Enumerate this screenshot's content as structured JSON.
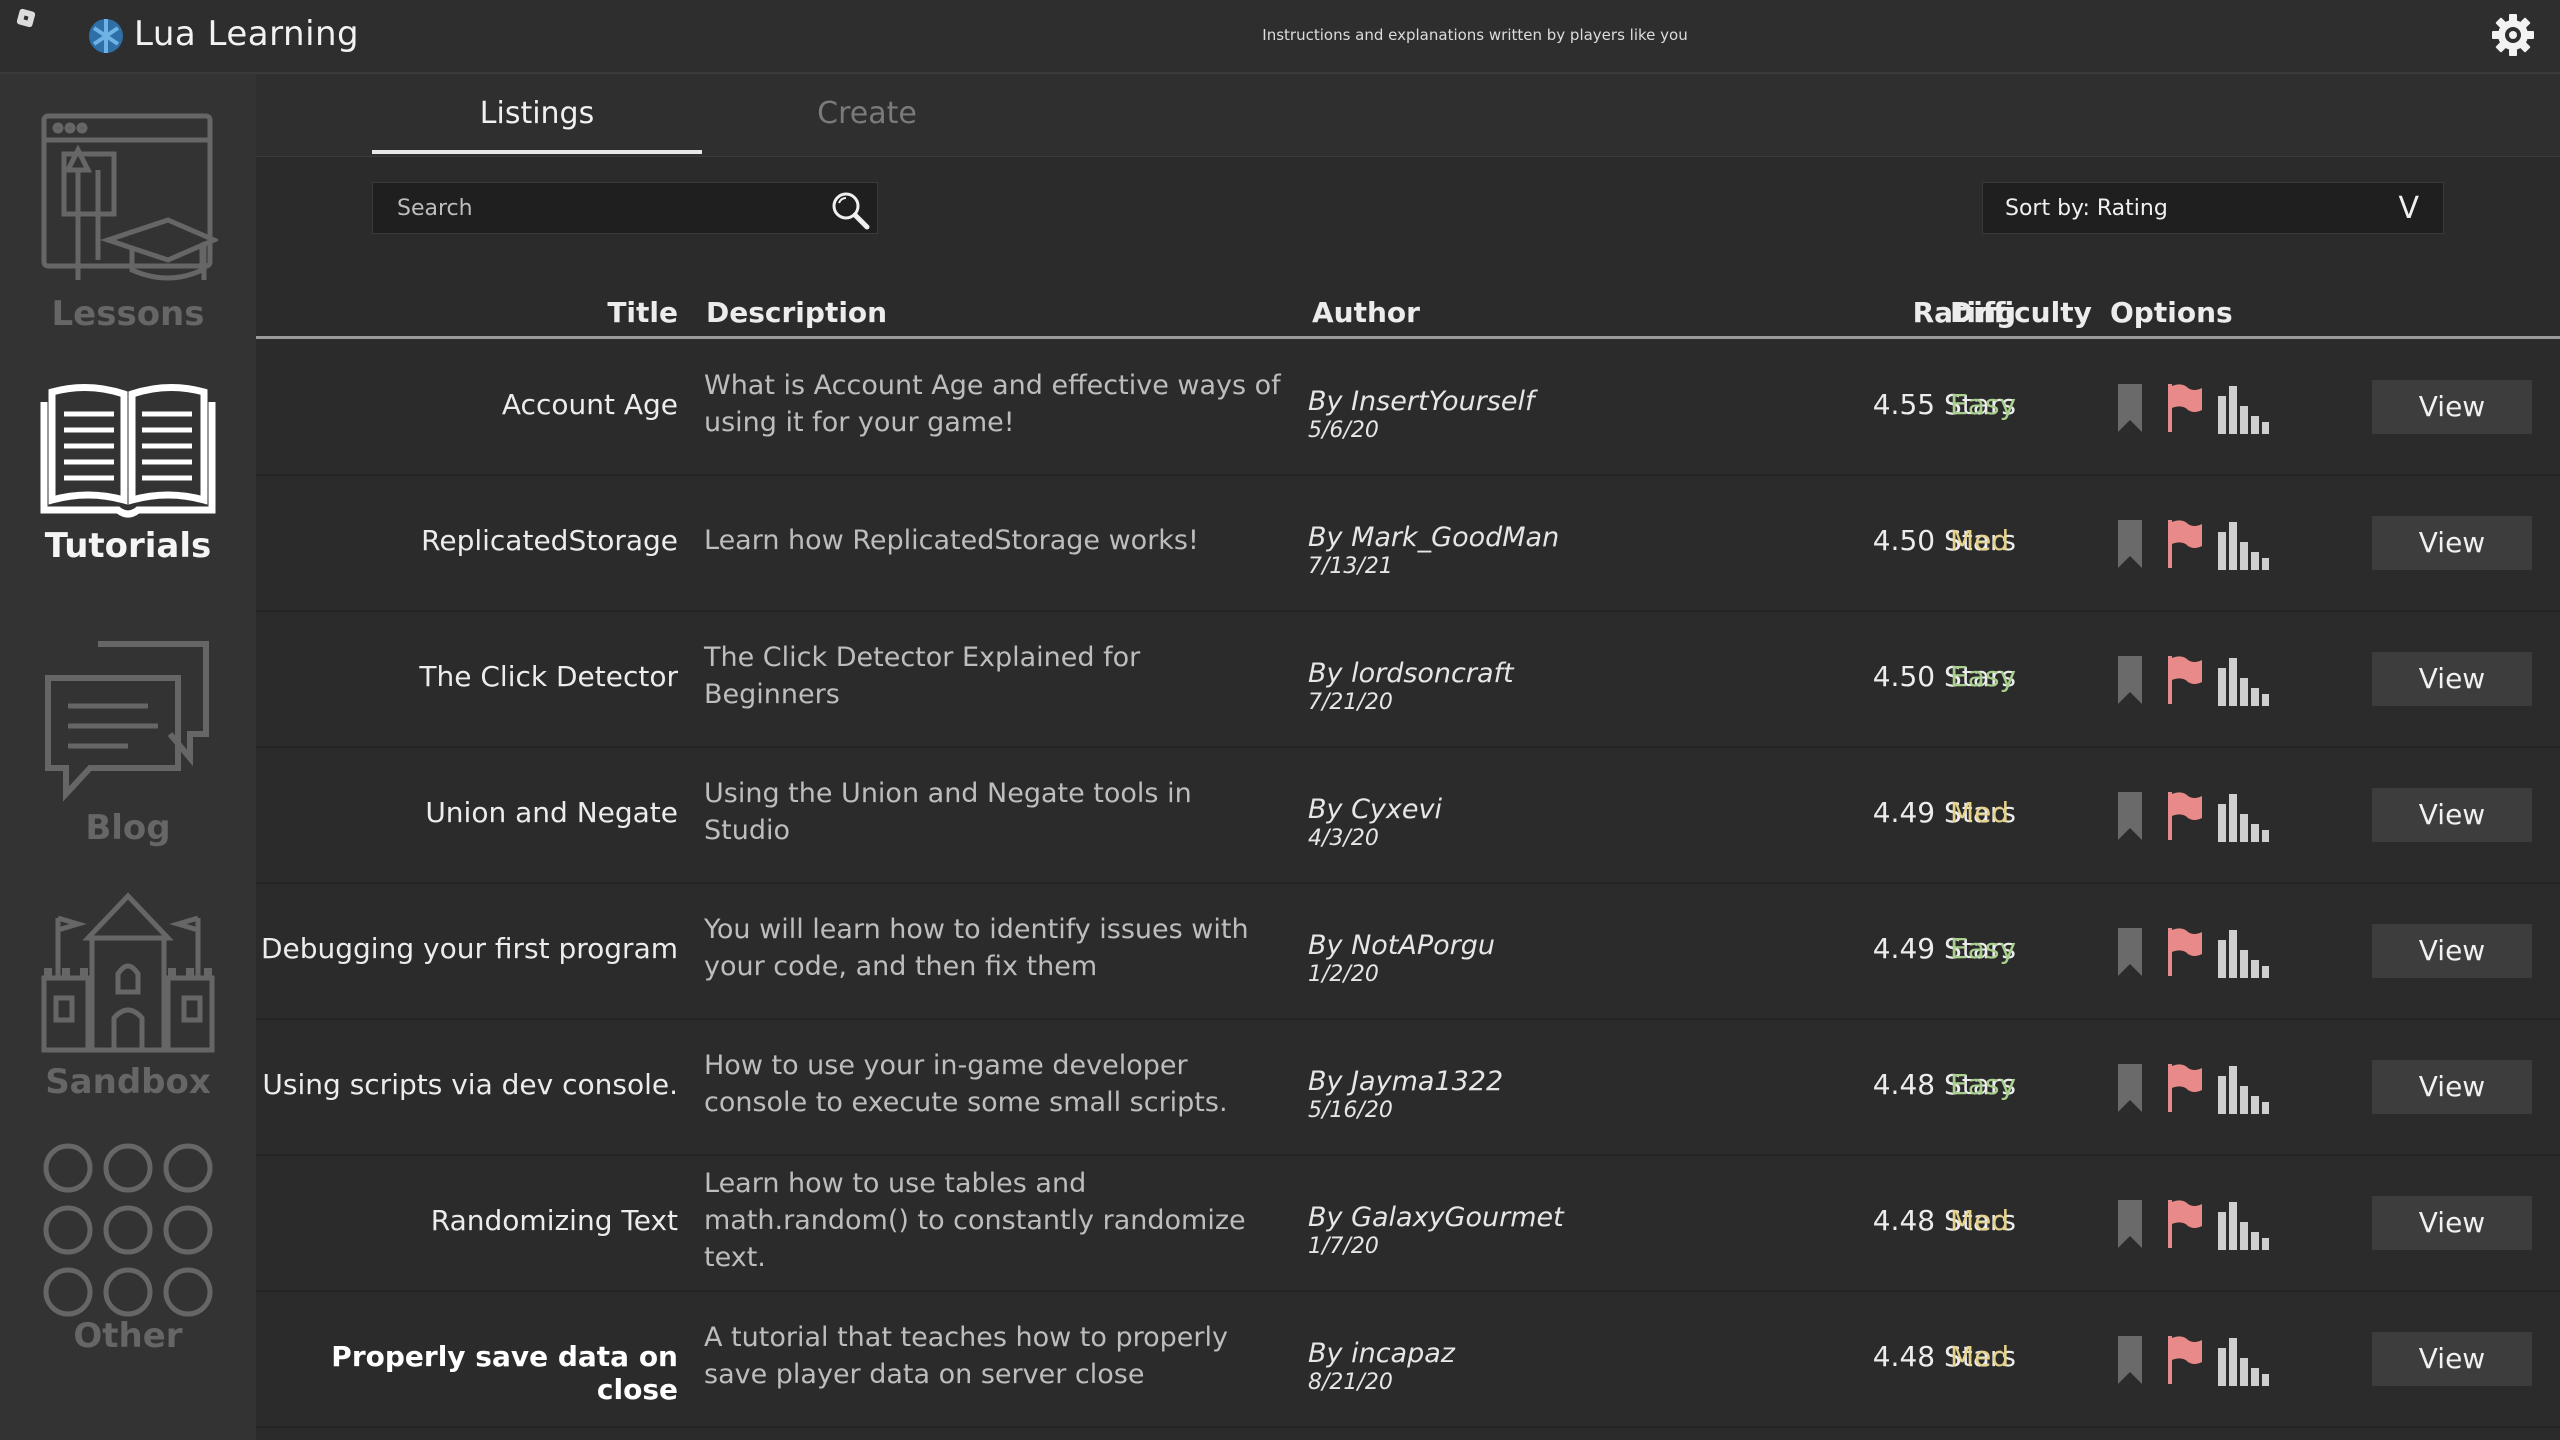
{
  "app": {
    "title": "Lua Learning",
    "tagline": "Instructions and explanations written by players like you"
  },
  "sidebar": {
    "items": [
      {
        "label": "Lessons",
        "icon": "lessons-board-icon",
        "active": false
      },
      {
        "label": "Tutorials",
        "icon": "open-book-icon",
        "active": true
      },
      {
        "label": "Blog",
        "icon": "chat-bubbles-icon",
        "active": false
      },
      {
        "label": "Sandbox",
        "icon": "castle-icon",
        "active": false
      },
      {
        "label": "Other",
        "icon": "circle-grid-icon",
        "active": false
      }
    ]
  },
  "tabs": [
    {
      "label": "Listings",
      "active": true
    },
    {
      "label": "Create",
      "active": false
    }
  ],
  "search": {
    "placeholder": "Search",
    "value": ""
  },
  "sort": {
    "label": "Sort by: Rating",
    "chevron": "V"
  },
  "table": {
    "headers": {
      "title": "Title",
      "description": "Description",
      "author": "Author",
      "rating": "Rating",
      "difficulty": "Difficulty",
      "options": "Options"
    },
    "view_label": "View",
    "rows": [
      {
        "title": "Account Age",
        "description": "What is Account Age and effective ways of using it for your game!",
        "author": "By InsertYourself",
        "date": "5/6/20",
        "rating": "4.55 Stars",
        "difficulty": "Easy"
      },
      {
        "title": "ReplicatedStorage",
        "description": "Learn how ReplicatedStorage works!",
        "author": "By Mark_GoodMan",
        "date": "7/13/21",
        "rating": "4.50 Stars",
        "difficulty": "Med"
      },
      {
        "title": "The Click Detector",
        "description": "The Click Detector Explained for Beginners",
        "author": "By lordsoncraft",
        "date": "7/21/20",
        "rating": "4.50 Stars",
        "difficulty": "Easy"
      },
      {
        "title": "Union and Negate",
        "description": "Using the Union and Negate tools in Studio",
        "author": "By Cyxevi",
        "date": "4/3/20",
        "rating": "4.49 Stars",
        "difficulty": "Med"
      },
      {
        "title": "Debugging your first program",
        "description": "You will learn how to identify issues with your code, and then fix them",
        "author": "By NotAPorgu",
        "date": "1/2/20",
        "rating": "4.49 Stars",
        "difficulty": "Easy"
      },
      {
        "title": "Using scripts via dev console.",
        "description": "How to use your in-game developer console to execute some small scripts.",
        "author": "By Jayma1322",
        "date": "5/16/20",
        "rating": "4.48 Stars",
        "difficulty": "Easy"
      },
      {
        "title": "Randomizing Text",
        "description": "Learn how to use tables and math.random() to constantly randomize text.",
        "author": "By GalaxyGourmet",
        "date": "1/7/20",
        "rating": "4.48 Stars",
        "difficulty": "Med"
      },
      {
        "title": "Properly save data on close",
        "description": "A tutorial that teaches how to properly save player data on server close",
        "author": "By incapaz",
        "date": "8/21/20",
        "rating": "4.48 Stars",
        "difficulty": "Med"
      }
    ]
  },
  "colors": {
    "easy": "#a8d08d",
    "med": "#e6d28a",
    "flag": "#e88a8a",
    "bookmark": "#6a6a6a",
    "stats": "#cfcfcf"
  }
}
